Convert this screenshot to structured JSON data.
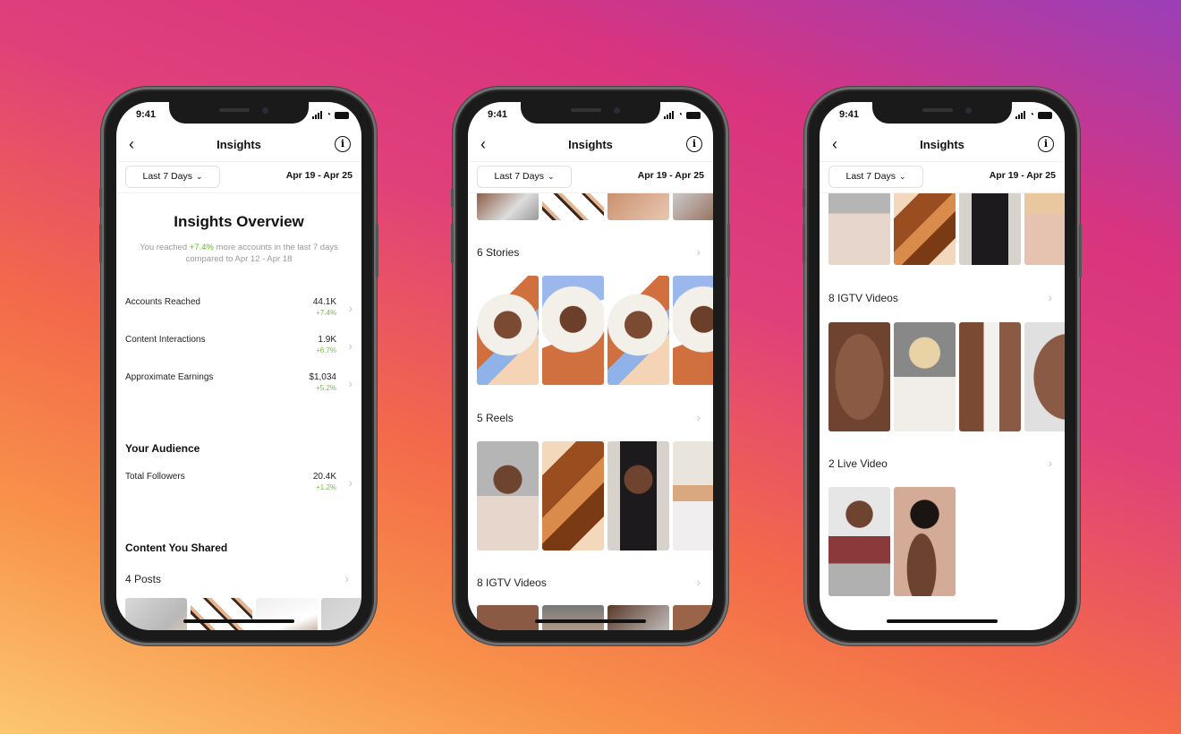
{
  "phones": [
    {
      "status": {
        "time": "9:41"
      },
      "header": {
        "title": "Insights",
        "back": "‹",
        "info": "i"
      },
      "filter": {
        "range": "Last 7 Days",
        "dates": "Apr 19 - Apr 25"
      },
      "overview": {
        "title": "Insights Overview",
        "sub_pre": "You reached ",
        "sub_pct": "+7.4%",
        "sub_post": " more accounts in the last 7 days compared to Apr 12 - Apr 18"
      },
      "metrics": [
        {
          "label": "Accounts Reached",
          "value": "44.1K",
          "change": "+7.4%"
        },
        {
          "label": "Content Interactions",
          "value": "1.9K",
          "change": "+6.7%"
        },
        {
          "label": "Approximate Earnings",
          "value": "$1,034",
          "change": "+5.2%"
        }
      ],
      "audience": {
        "title": "Your Audience",
        "label": "Total Followers",
        "value": "20.4K",
        "change": "+1.2%"
      },
      "content": {
        "title": "Content You Shared",
        "posts": "4 Posts"
      }
    },
    {
      "status": {
        "time": "9:41"
      },
      "header": {
        "title": "Insights",
        "back": "‹",
        "info": "i"
      },
      "filter": {
        "range": "Last 7 Days",
        "dates": "Apr 19 - Apr 25"
      },
      "sections": [
        {
          "label": "6 Stories"
        },
        {
          "label": "5 Reels"
        },
        {
          "label": "8 IGTV Videos"
        }
      ]
    },
    {
      "status": {
        "time": "9:41"
      },
      "header": {
        "title": "Insights",
        "back": "‹",
        "info": "i"
      },
      "filter": {
        "range": "Last 7 Days",
        "dates": "Apr 19 - Apr 25"
      },
      "sections": [
        {
          "label": "8 IGTV Videos"
        },
        {
          "label": "2 Live Video"
        }
      ]
    }
  ],
  "icons": {
    "chevron_down": "⌄",
    "chevron_right": "›"
  }
}
